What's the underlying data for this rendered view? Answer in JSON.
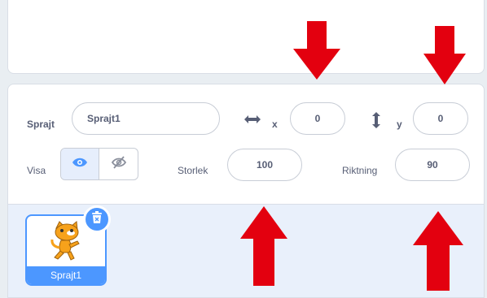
{
  "sprite": {
    "label": "Sprajt",
    "name_value": "Sprajt1",
    "x_label": "x",
    "x_value": "0",
    "y_label": "y",
    "y_value": "0"
  },
  "show": {
    "label": "Visa"
  },
  "size": {
    "label": "Storlek",
    "value": "100"
  },
  "direction": {
    "label": "Riktning",
    "value": "90"
  },
  "sprite_list": {
    "items": [
      {
        "name": "Sprajt1",
        "selected": true
      }
    ]
  },
  "icons": {
    "x_arrow": "horizontal-double-arrow-icon",
    "y_arrow": "vertical-double-arrow-icon",
    "show": "eye-icon",
    "hide": "eye-slash-icon",
    "delete": "trash-icon"
  },
  "colors": {
    "accent": "#4c97ff",
    "arrow": "#e3000f",
    "text": "#575e75"
  }
}
